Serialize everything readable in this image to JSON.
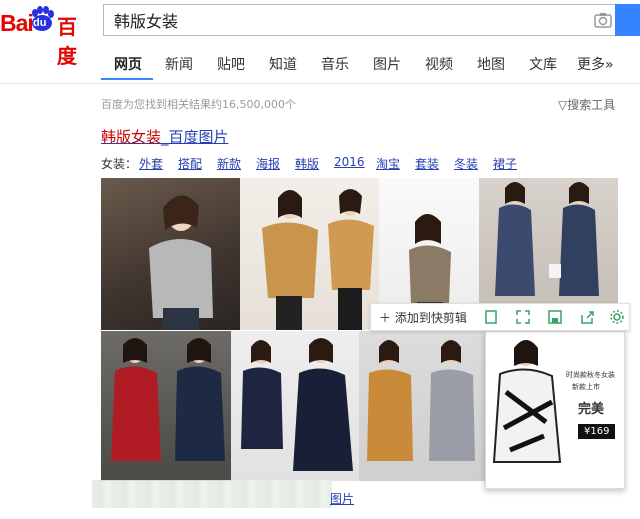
{
  "logo": {
    "part1": "Bai",
    "part2": "du",
    "part3": "百度"
  },
  "search": {
    "query": "韩版女装"
  },
  "nav": {
    "tabs": [
      {
        "label": "网页",
        "active": true
      },
      {
        "label": "新闻"
      },
      {
        "label": "贴吧"
      },
      {
        "label": "知道"
      },
      {
        "label": "音乐"
      },
      {
        "label": "图片"
      },
      {
        "label": "视频"
      },
      {
        "label": "地图"
      },
      {
        "label": "文库"
      },
      {
        "label": "更多»"
      }
    ]
  },
  "results": {
    "count_text": "百度为您找到相关结果约16,500,000个",
    "tools_label": "▽搜索工具",
    "title_highlight": "韩版女装",
    "title_rest": "_百度图片",
    "tags_label": "女装：",
    "tags": [
      "外套",
      "搭配",
      "新款",
      "海报",
      "韩版",
      "2016",
      "淘宝",
      "套装",
      "冬装",
      "裙子"
    ],
    "caption_suffix": "图片"
  },
  "clip_toolbar": {
    "add_label": "添加到快剪辑"
  },
  "ad": {
    "line1": "时尚款秋冬女装",
    "line2": "新款上市",
    "headline": "完美",
    "price": "¥169"
  },
  "colors": {
    "accent": "#3385ff",
    "link": "#2440b3",
    "highlight": "#cc0000",
    "brand_red": "#e10602"
  }
}
